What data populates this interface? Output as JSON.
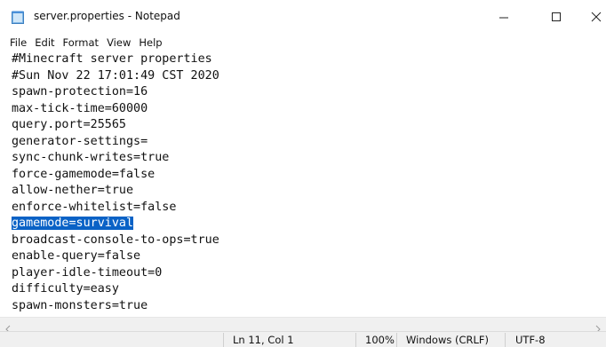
{
  "window": {
    "title": "server.properties - Notepad",
    "app_icon": "notepad-icon",
    "controls": {
      "minimize": "minimize-icon",
      "maximize": "maximize-icon",
      "close": "close-icon"
    }
  },
  "menu": {
    "items": [
      "File",
      "Edit",
      "Format",
      "View",
      "Help"
    ]
  },
  "editor": {
    "lines": [
      "#Minecraft server properties",
      "#Sun Nov 22 17:01:49 CST 2020",
      "spawn-protection=16",
      "max-tick-time=60000",
      "query.port=25565",
      "generator-settings=",
      "sync-chunk-writes=true",
      "force-gamemode=false",
      "allow-nether=true",
      "enforce-whitelist=false",
      "gamemode=survival",
      "broadcast-console-to-ops=true",
      "enable-query=false",
      "player-idle-timeout=0",
      "difficulty=easy",
      "spawn-monsters=true"
    ],
    "selected_line_text": "gamemode=survival",
    "selection_color": "#0a62c6"
  },
  "statusbar": {
    "position": "Ln 11, Col 1",
    "zoom": "100%",
    "line_ending": "Windows (CRLF)",
    "encoding": "UTF-8"
  }
}
